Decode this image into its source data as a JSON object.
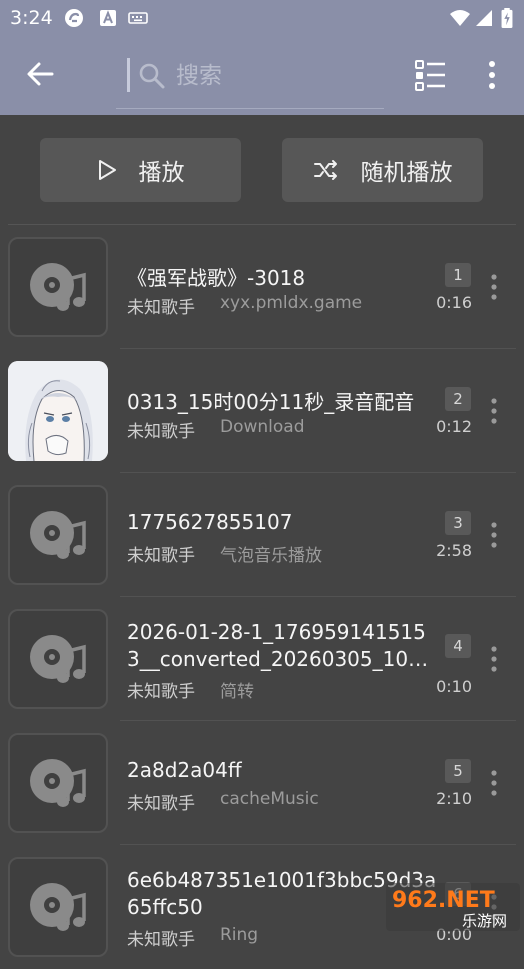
{
  "status": {
    "time": "3:24"
  },
  "search": {
    "placeholder": "搜索"
  },
  "actions": {
    "play_label": "播放",
    "shuffle_label": "随机播放"
  },
  "songs": [
    {
      "title": "《强军战歌》-3018",
      "artist": "未知歌手",
      "album": "xyx.pmldx.game",
      "index": "1",
      "duration": "0:16",
      "thumb": "disc-icon"
    },
    {
      "title": "0313_15时00分11秒_录音配音",
      "artist": "未知歌手",
      "album": "Download",
      "index": "2",
      "duration": "0:12",
      "thumb": "anime-girl-artwork"
    },
    {
      "title": "1775627855107",
      "artist": "未知歌手",
      "album": "气泡音乐播放",
      "index": "3",
      "duration": "2:58",
      "thumb": "disc-icon"
    },
    {
      "title": "2026-01-28-1_1769591415153__converted_20260305_10…",
      "artist": "未知歌手",
      "album": "简转",
      "index": "4",
      "duration": "0:10",
      "thumb": "disc-icon"
    },
    {
      "title": "2a8d2a04ff",
      "artist": "未知歌手",
      "album": "cacheMusic",
      "index": "5",
      "duration": "2:10",
      "thumb": "disc-icon"
    },
    {
      "title": "6e6b487351e1001f3bbc59d3a65ffc50",
      "artist": "未知歌手",
      "album": "Ring",
      "index": "6",
      "duration": "0:00",
      "thumb": "disc-icon"
    }
  ],
  "watermark": {
    "brand": "962.NET",
    "sub": "乐游网"
  },
  "colors": {
    "appbar": "#8a8fa8",
    "background": "#444444",
    "button": "#575757"
  }
}
